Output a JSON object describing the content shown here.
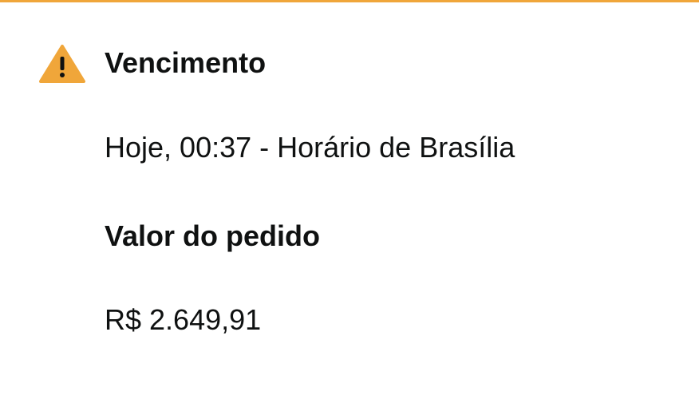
{
  "colors": {
    "accent": "#f0a63a",
    "warning_icon": "#f0a63a",
    "text": "#0f1111"
  },
  "alert": {
    "icon": "warning-triangle-icon",
    "due_label": "Vencimento",
    "due_value": "Hoje, 00:37 - Horário de Brasília",
    "amount_label": "Valor do pedido",
    "amount_value": "R$ 2.649,91"
  }
}
